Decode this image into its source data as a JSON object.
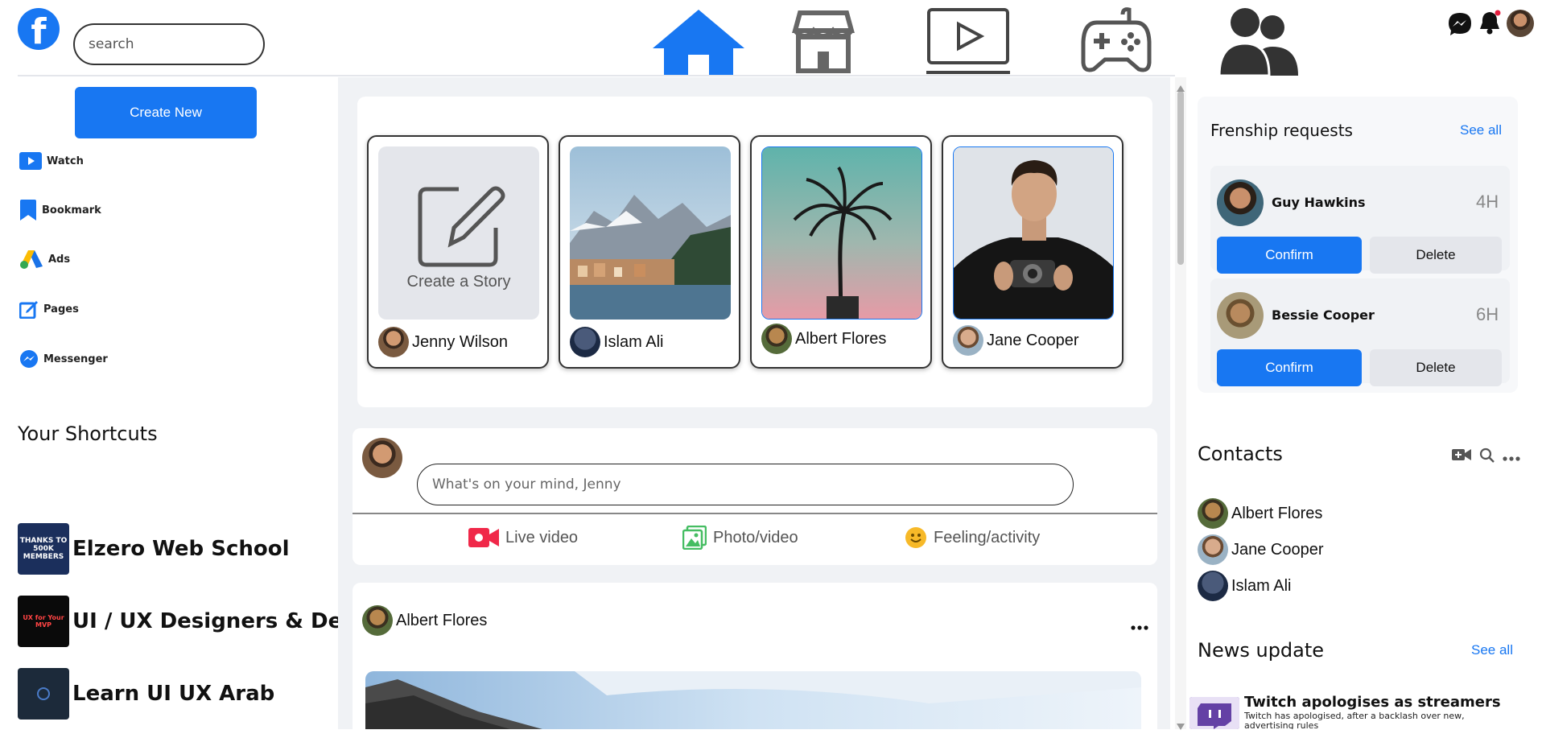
{
  "header": {
    "logo_letter": "f",
    "search_placeholder": "search"
  },
  "sidebar": {
    "create_new_label": "Create New",
    "items": [
      {
        "label": "Watch",
        "icon": "watch-icon"
      },
      {
        "label": "Bookmark",
        "icon": "bookmark-icon"
      },
      {
        "label": "Ads",
        "icon": "ads-icon"
      },
      {
        "label": "Pages",
        "icon": "pages-icon"
      },
      {
        "label": "Messenger",
        "icon": "messenger-icon"
      }
    ],
    "shortcuts_title": "Your Shortcuts",
    "shortcuts": [
      {
        "label": "Elzero Web School",
        "thumb_text": "THANKS TO 500K MEMBERS"
      },
      {
        "label": "UI / UX Designers & Developers",
        "thumb_text": "UX for Your MVP"
      },
      {
        "label": "Learn UI UX Arab",
        "thumb_text": ""
      }
    ]
  },
  "stories": {
    "create_label": "Create a Story",
    "items": [
      {
        "name": "Jenny Wilson"
      },
      {
        "name": "Islam Ali"
      },
      {
        "name": "Albert Flores"
      },
      {
        "name": "Jane Cooper"
      }
    ]
  },
  "composer": {
    "placeholder": "What's on your mind, Jenny",
    "actions": [
      {
        "label": "Live video",
        "icon": "live-video-icon"
      },
      {
        "label": "Photo/video",
        "icon": "photo-icon"
      },
      {
        "label": "Feeling/activity",
        "icon": "smiley-icon"
      }
    ]
  },
  "post": {
    "author": "Albert Flores",
    "menu_icon": "more-icon"
  },
  "friend_requests": {
    "title": "Frenship requests",
    "see_all": "See all",
    "items": [
      {
        "name": "Guy Hawkins",
        "time": "4H",
        "confirm": "Confirm",
        "delete": "Delete"
      },
      {
        "name": "Bessie Cooper",
        "time": "6H",
        "confirm": "Confirm",
        "delete": "Delete"
      }
    ]
  },
  "contacts": {
    "title": "Contacts",
    "items": [
      {
        "name": "Albert Flores"
      },
      {
        "name": "Jane Cooper"
      },
      {
        "name": "Islam Ali"
      }
    ]
  },
  "news": {
    "title": "News update",
    "see_all": "See all",
    "items": [
      {
        "headline": "Twitch apologises as streamers",
        "summary": "Twitch has apologised, after a backlash over new, advertising rules"
      }
    ]
  },
  "colors": {
    "accent": "#1877f2",
    "background": "#f0f2f5"
  }
}
